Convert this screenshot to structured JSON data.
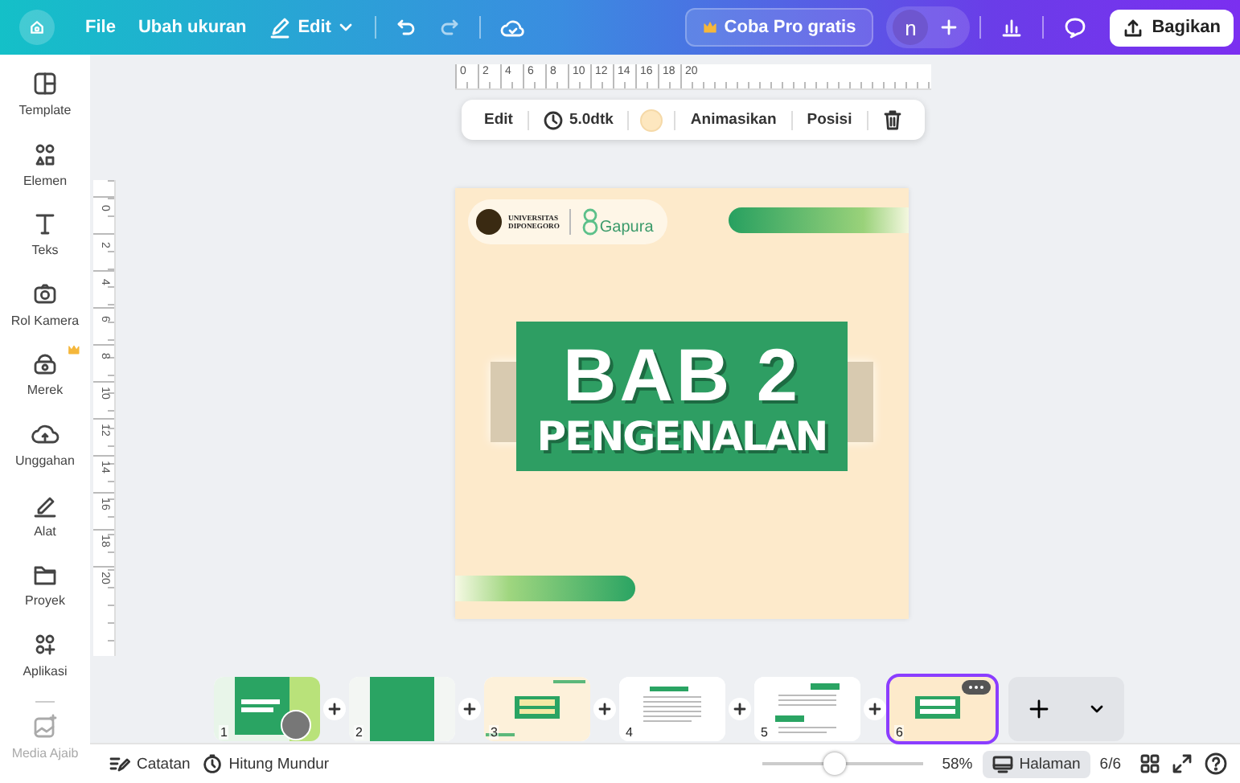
{
  "topbar": {
    "menu": [
      {
        "label": "File"
      },
      {
        "label": "Ubah ukuran"
      },
      {
        "label": "Edit"
      }
    ],
    "pro_button": "Coba Pro gratis",
    "avatar": "n",
    "share_button": "Bagikan"
  },
  "sidebar": {
    "items": [
      {
        "label": "Template",
        "pro": false
      },
      {
        "label": "Elemen",
        "pro": false
      },
      {
        "label": "Teks",
        "pro": false
      },
      {
        "label": "Rol Kamera",
        "pro": false
      },
      {
        "label": "Merek",
        "pro": true
      },
      {
        "label": "Unggahan",
        "pro": false
      },
      {
        "label": "Alat",
        "pro": false
      },
      {
        "label": "Proyek",
        "pro": false
      },
      {
        "label": "Aplikasi",
        "pro": false
      },
      {
        "label": "Media Ajaib",
        "pro": false
      }
    ]
  },
  "rulers": {
    "horizontal": [
      "0",
      "2",
      "4",
      "6",
      "8",
      "10",
      "12",
      "14",
      "16",
      "18",
      "20"
    ],
    "vertical": [
      "0",
      "2",
      "4",
      "6",
      "8",
      "10",
      "12",
      "14",
      "16",
      "18",
      "20"
    ]
  },
  "element_toolbar": {
    "edit": "Edit",
    "duration": "5.0dtk",
    "animate": "Animasikan",
    "position": "Posisi"
  },
  "design": {
    "logo_line_1": "UNIVERSITAS",
    "logo_line_2": "DIPONEGORO",
    "logo_brand": "Gapura",
    "title": "BAB 2",
    "subtitle": "PENGENALAN"
  },
  "pages": [
    {
      "number": "1",
      "selected": false
    },
    {
      "number": "2",
      "selected": false
    },
    {
      "number": "3",
      "selected": false
    },
    {
      "number": "4",
      "selected": false
    },
    {
      "number": "5",
      "selected": false
    },
    {
      "number": "6",
      "selected": true
    }
  ],
  "footer": {
    "notes": "Catatan",
    "timer": "Hitung Mundur",
    "zoom": {
      "level": 0.45
    },
    "zoom_reading": "58%",
    "pages_button": "Halaman",
    "page_count": "6/6"
  }
}
